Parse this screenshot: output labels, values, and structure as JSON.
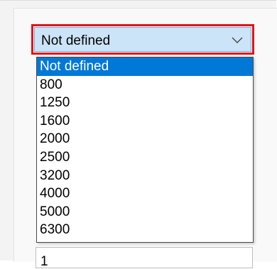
{
  "combo": {
    "value": "Not defined",
    "arrow_icon": "chevron-down-icon"
  },
  "dropdown": {
    "options": [
      {
        "label": "Not defined",
        "selected": true
      },
      {
        "label": "800",
        "selected": false
      },
      {
        "label": "1250",
        "selected": false
      },
      {
        "label": "1600",
        "selected": false
      },
      {
        "label": "2000",
        "selected": false
      },
      {
        "label": "2500",
        "selected": false
      },
      {
        "label": "3200",
        "selected": false
      },
      {
        "label": "4000",
        "selected": false
      },
      {
        "label": "5000",
        "selected": false
      },
      {
        "label": "6300",
        "selected": false
      }
    ]
  },
  "next_field": {
    "value": "1"
  },
  "colors": {
    "highlight": "#e0141b",
    "selection": "#0078d7",
    "combo_face": "#cce4f7"
  }
}
